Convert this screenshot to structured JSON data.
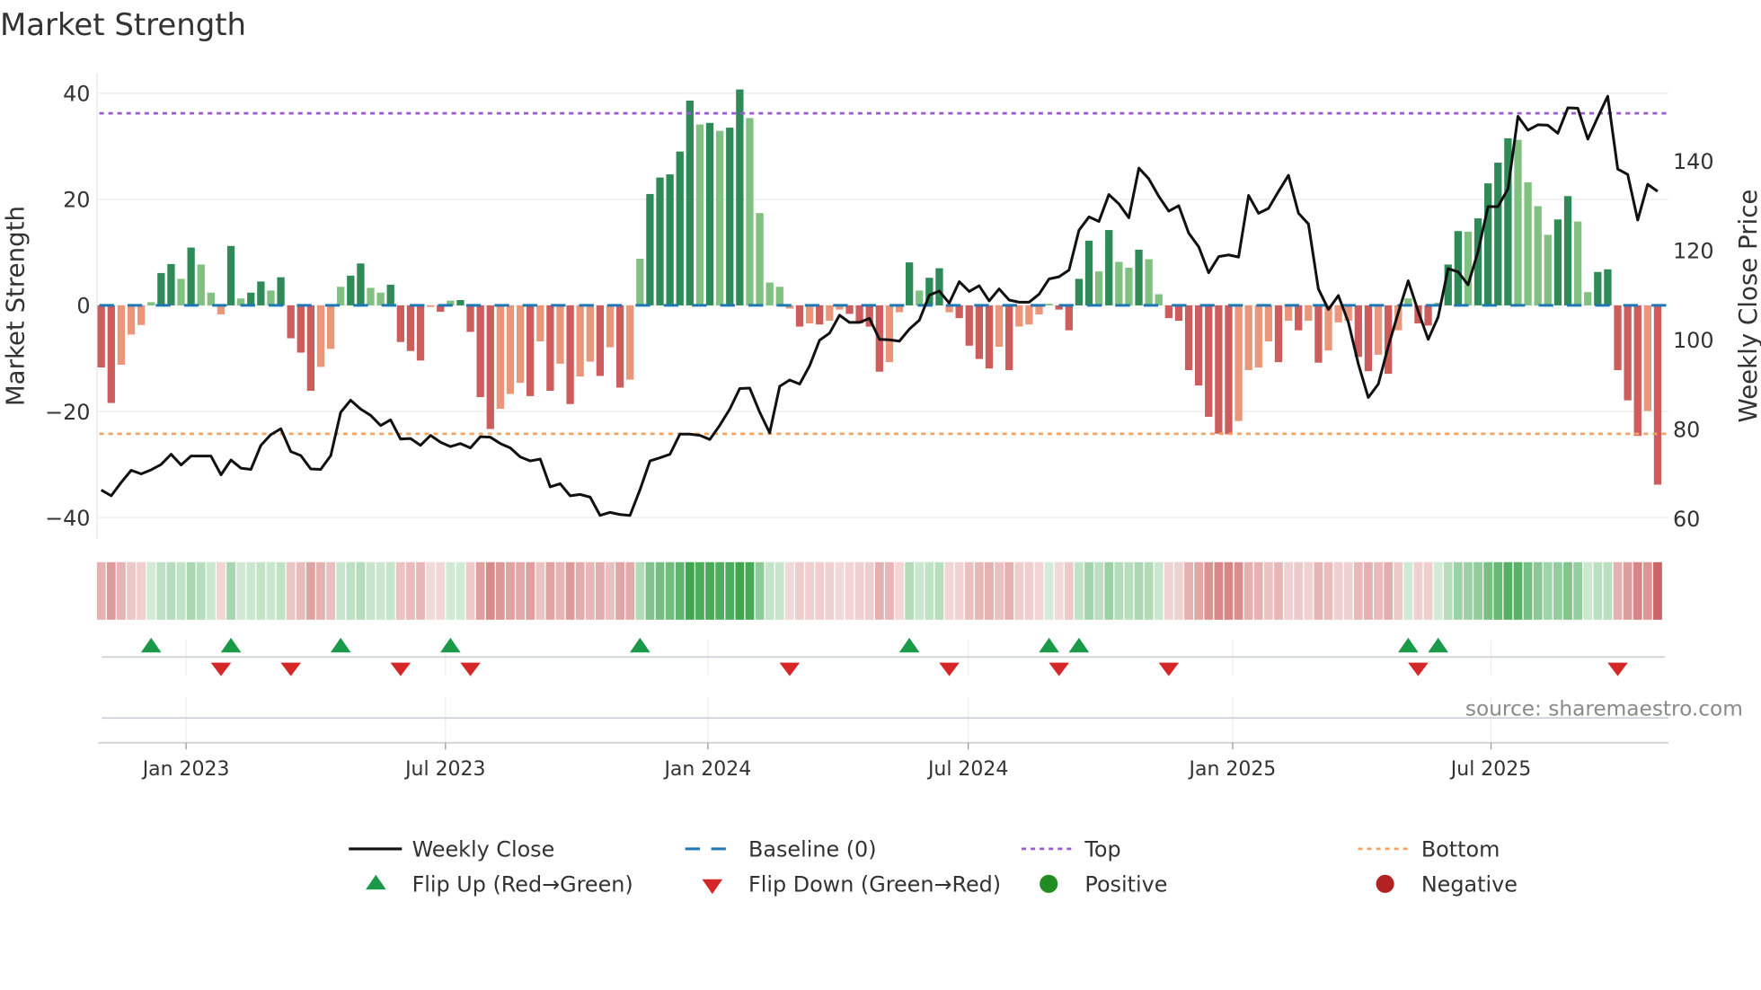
{
  "title": "Market Strength",
  "source": "source: sharemaestro.com",
  "colors": {
    "pos_dark": "#2e8b57",
    "pos_light": "#80c080",
    "neg_dark": "#cd5c5c",
    "neg_light": "#e9967a",
    "baseline": "#1f77b4",
    "top": "#9b59d6",
    "bottom": "#f4a460",
    "flip_up": "#1a9a48",
    "flip_down": "#d62728",
    "positive": "#228b22",
    "negative": "#b22222",
    "close": "#111111"
  },
  "chart_data": {
    "type": "bar",
    "title": "Market Strength",
    "ylabel": "Market Strength",
    "y2label": "Weekly Close Price",
    "ylim": [
      -44,
      44
    ],
    "y2lim": [
      60,
      160
    ],
    "yticks": [
      "40",
      "20",
      "0",
      "−20",
      "−40"
    ],
    "ytick_values": [
      40,
      20,
      0,
      -20,
      -40
    ],
    "y2ticks": [
      "140",
      "120",
      "100",
      "80",
      "60"
    ],
    "y2tick_values": [
      140,
      120,
      100,
      80,
      60
    ],
    "xticks": [
      "Jan 2023",
      "Jul 2023",
      "Jan 2024",
      "Jul 2024",
      "Jan 2025",
      "Jul 2025"
    ],
    "xtick_week_index": [
      8.5,
      34.5,
      60.8,
      86.9,
      113.4,
      139.3
    ],
    "top_level": 36.2,
    "bottom_level": -24.2,
    "grid": true,
    "legend_position": "bottom",
    "strength": [
      -11.7,
      -18.4,
      -11.2,
      -5.5,
      -3.7,
      0.6,
      6.1,
      7.8,
      5.0,
      10.9,
      7.7,
      2.4,
      -1.7,
      11.2,
      1.3,
      2.4,
      4.5,
      2.8,
      5.3,
      -6.2,
      -8.9,
      -16.1,
      -11.6,
      -8.2,
      3.5,
      5.6,
      7.9,
      3.3,
      2.4,
      3.9,
      -6.9,
      -8.6,
      -10.4,
      -0.3,
      -1.2,
      0.9,
      1.0,
      -5.0,
      -17.3,
      -23.3,
      -19.5,
      -16.7,
      -14.6,
      -17.1,
      -6.8,
      -16.1,
      -11.0,
      -18.6,
      -13.4,
      -10.6,
      -13.3,
      -7.9,
      -15.5,
      -14.0,
      8.8,
      21.0,
      24.1,
      24.7,
      29.0,
      38.6,
      34.1,
      34.4,
      32.9,
      33.5,
      40.7,
      35.3,
      17.4,
      4.3,
      3.5,
      -0.6,
      -4.0,
      -3.4,
      -3.6,
      -2.9,
      -0.8,
      -1.6,
      -3.4,
      -4.0,
      -12.5,
      -10.7,
      -1.3,
      8.1,
      2.8,
      5.2,
      7.0,
      -1.3,
      -2.4,
      -7.6,
      -10.1,
      -11.9,
      -7.8,
      -12.2,
      -4.0,
      -3.6,
      -1.7,
      0.3,
      -0.8,
      -4.7,
      5.0,
      12.2,
      6.4,
      14.2,
      8.2,
      7.1,
      10.5,
      8.7,
      2.1,
      -2.4,
      -2.9,
      -12.2,
      -15.1,
      -21.0,
      -24.2,
      -24.3,
      -21.8,
      -12.2,
      -11.7,
      -6.8,
      -10.7,
      -2.9,
      -4.7,
      -2.9,
      -10.8,
      -8.5,
      -3.2,
      -2.9,
      -9.7,
      -12.4,
      -9.3,
      -12.9,
      -4.7,
      1.3,
      -3.4,
      -3.8,
      0.5,
      7.7,
      14.0,
      13.9,
      16.4,
      23.0,
      26.9,
      31.5,
      31.2,
      23.2,
      18.7,
      13.3,
      16.2,
      20.6,
      15.8,
      2.5,
      6.3,
      6.8,
      -12.2,
      -17.9,
      -24.6,
      -19.9,
      -33.8
    ],
    "weekly_close": [
      66.4,
      65.1,
      68.1,
      70.8,
      70.0,
      70.9,
      72.1,
      74.4,
      72.0,
      74.0,
      74.0,
      74.0,
      69.8,
      73.1,
      71.3,
      71.0,
      76.4,
      78.8,
      80.1,
      75.0,
      74.1,
      71.1,
      71.0,
      74.1,
      83.8,
      86.5,
      84.5,
      83.1,
      80.8,
      82.1,
      77.8,
      77.9,
      76.4,
      78.6,
      77.1,
      76.1,
      76.8,
      75.8,
      78.3,
      78.2,
      76.8,
      75.8,
      73.8,
      72.9,
      73.3,
      67.1,
      67.8,
      65.1,
      65.4,
      64.8,
      60.7,
      61.4,
      60.9,
      60.7,
      66.5,
      72.9,
      73.6,
      74.4,
      78.9,
      78.9,
      78.6,
      77.7,
      80.9,
      84.5,
      89.1,
      89.2,
      83.8,
      79.2,
      89.6,
      91.0,
      90.1,
      94.2,
      99.9,
      101.5,
      105.5,
      103.9,
      103.9,
      104.8,
      100.1,
      100.0,
      99.7,
      102.4,
      104.4,
      110.0,
      110.9,
      108.2,
      113.0,
      110.8,
      112.1,
      108.7,
      111.4,
      108.9,
      108.4,
      108.4,
      110.2,
      113.6,
      114.1,
      115.6,
      124.5,
      127.5,
      126.5,
      132.5,
      130.4,
      127.3,
      138.4,
      136.0,
      132.1,
      128.8,
      130.0,
      123.9,
      120.8,
      115.0,
      118.6,
      119.0,
      118.5,
      132.3,
      128.3,
      129.4,
      133.2,
      136.8,
      128.3,
      125.9,
      111.4,
      106.8,
      109.9,
      103.9,
      94.6,
      87.1,
      90.1,
      98.5,
      106.0,
      113.2,
      106.4,
      100.1,
      105.1,
      115.9,
      115.2,
      112.3,
      119.7,
      129.8,
      129.8,
      133.8,
      150.0,
      146.9,
      148.1,
      148.0,
      146.2,
      151.9,
      151.8,
      144.9,
      149.8,
      154.5,
      138.2,
      137.0,
      126.8,
      134.8,
      133.2
    ]
  },
  "legend": {
    "weekly_close": "Weekly Close",
    "baseline": "Baseline (0)",
    "top": "Top",
    "bottom": "Bottom",
    "flip_up": "Flip Up (Red→Green)",
    "flip_down": "Flip Down (Green→Red)",
    "positive": "Positive",
    "negative": "Negative"
  }
}
